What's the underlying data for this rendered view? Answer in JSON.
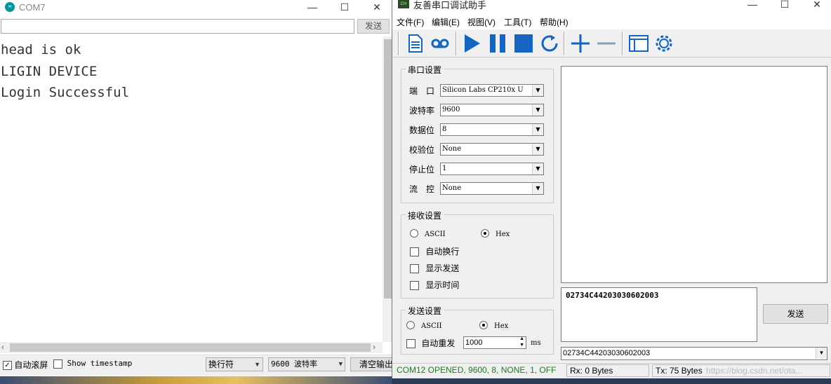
{
  "left_window": {
    "title": "COM7",
    "send_input_value": "",
    "send_label": "发送",
    "output_lines": [
      "head is ok",
      "LIGIN DEVICE",
      "Login Successful"
    ],
    "autoscroll_label": "自动滚屏",
    "autoscroll_checked": true,
    "timestamp_label": "Show timestamp",
    "timestamp_checked": false,
    "line_ending": "换行符",
    "baud": "9600 波特率",
    "clear_label": "清空输出"
  },
  "right_window": {
    "title": "友善串口调试助手",
    "menus": [
      "文件(F)",
      "编辑(E)",
      "视图(V)",
      "工具(T)",
      "帮助(H)"
    ],
    "serial_settings": {
      "title": "串口设置",
      "port_label": "端　口",
      "port_value": "Silicon Labs CP210x U",
      "baud_label": "波特率",
      "baud_value": "9600",
      "databits_label": "数据位",
      "databits_value": "8",
      "parity_label": "校验位",
      "parity_value": "None",
      "stopbits_label": "停止位",
      "stopbits_value": "1",
      "flow_label": "流　控",
      "flow_value": "None"
    },
    "receive_settings": {
      "title": "接收设置",
      "ascii_label": "ASCII",
      "hex_label": "Hex",
      "selected": "Hex",
      "autowrap_label": "自动换行",
      "show_send_label": "显示发送",
      "show_time_label": "显示时间"
    },
    "send_settings": {
      "title": "发送设置",
      "ascii_label": "ASCII",
      "hex_label": "Hex",
      "selected": "Hex",
      "auto_resend_label": "自动重发",
      "interval_value": "1000",
      "interval_unit": "ms"
    },
    "receive_text": "",
    "send_text": "02734C44203030602003",
    "send_button": "发送",
    "history_value": "02734C44203030602003",
    "status": {
      "port_status": "COM12 OPENED, 9600, 8, NONE, 1, OFF",
      "rx": "Rx: 0 Bytes",
      "tx": "Tx: 75 Bytes",
      "watermark": "https://blog.csdn.net/ota..."
    },
    "colors": {
      "status_green": "#1e7b1e",
      "toolbar_blue": "#1565c0"
    }
  }
}
